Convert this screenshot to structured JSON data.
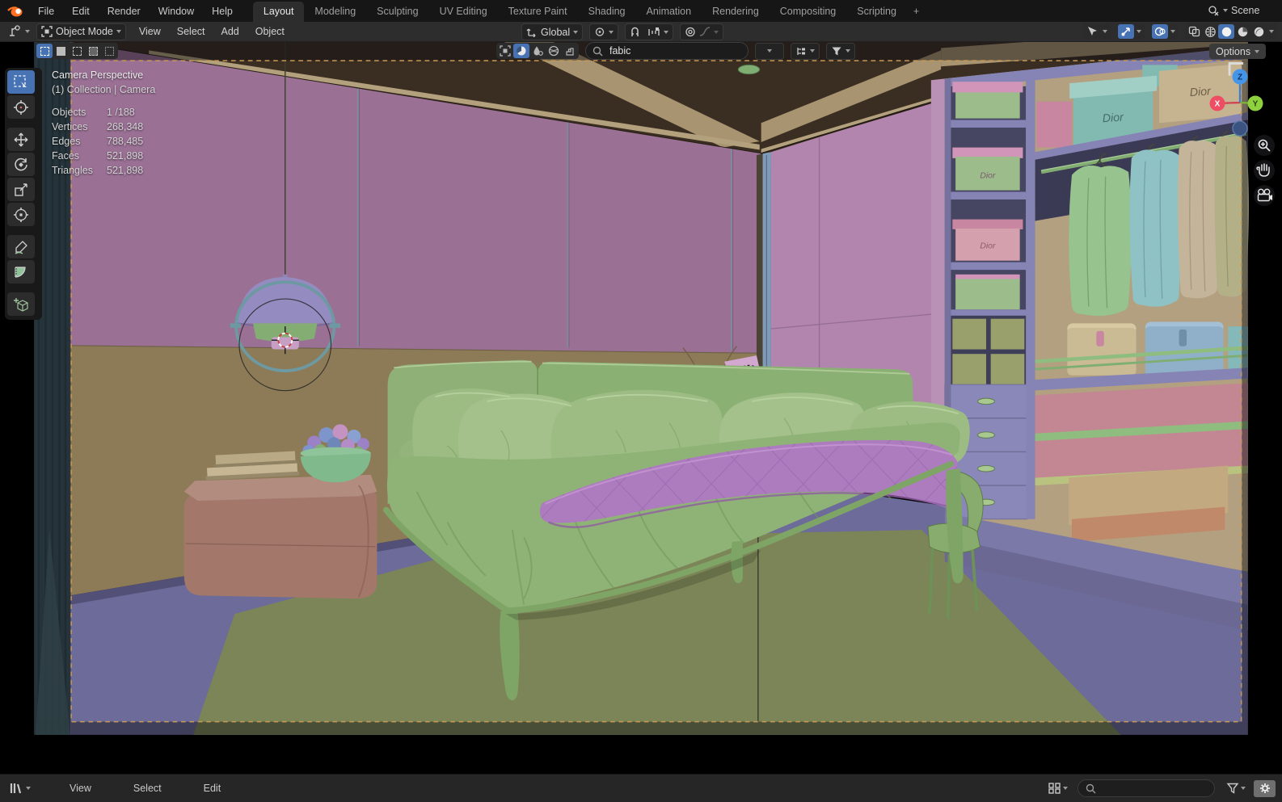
{
  "topbar": {
    "app_menus": [
      "File",
      "Edit",
      "Render",
      "Window",
      "Help"
    ],
    "workspace_tabs": [
      {
        "label": "Layout",
        "active": true
      },
      {
        "label": "Modeling",
        "active": false
      },
      {
        "label": "Sculpting",
        "active": false
      },
      {
        "label": "UV Editing",
        "active": false
      },
      {
        "label": "Texture Paint",
        "active": false
      },
      {
        "label": "Shading",
        "active": false
      },
      {
        "label": "Animation",
        "active": false
      },
      {
        "label": "Rendering",
        "active": false
      },
      {
        "label": "Compositing",
        "active": false
      },
      {
        "label": "Scripting",
        "active": false
      }
    ],
    "add_workspace_label": "+",
    "scene_name": "Scene"
  },
  "viewport_header": {
    "mode_label": "Object Mode",
    "menus": [
      "View",
      "Select",
      "Add",
      "Object"
    ],
    "orientation_label": "Global"
  },
  "tool_settings": {
    "search_value": "fabic",
    "options_label": "Options"
  },
  "viewport_overlay": {
    "view_title": "Camera Perspective",
    "view_subtitle": "(1) Collection | Camera",
    "stats": [
      {
        "label": "Objects",
        "value": "1 /188"
      },
      {
        "label": "Vertices",
        "value": "268,348"
      },
      {
        "label": "Edges",
        "value": "788,485"
      },
      {
        "label": "Faces",
        "value": "521,898"
      },
      {
        "label": "Triangles",
        "value": "521,898"
      }
    ]
  },
  "axis_gizmo": {
    "x_label": "X",
    "y_label": "Y",
    "z_label": "Z"
  },
  "status_bar": {
    "menus": [
      "View",
      "Select",
      "Edit"
    ],
    "search_value": ""
  },
  "scene": {
    "box_brand_label": "Dior"
  },
  "icons": {
    "blender-logo": "orange blender swirl",
    "editor-type-icon": "3d viewport",
    "object-mode-icon": "corner bracket square",
    "orientation-icon": "axes",
    "pivot-icon": "circle dot",
    "magnet-icon": "snap magnet",
    "snap-with-icon": "snap target",
    "proportional-icon": "concentric circles",
    "falloff-icon": "bell curve",
    "visibility-icon": "cursor eye",
    "gizmo-icon": "ne arrow",
    "overlays-icon": "two circles",
    "xray-icon": "overlap squares",
    "shading-wireframe-icon": "wire globe",
    "shading-solid-icon": "solid sphere",
    "shading-material-icon": "checker sphere",
    "shading-rendered-icon": "shaded sphere",
    "select-box-tool": "dashed square cursor",
    "cursor-tool": "crosshair circle",
    "move-tool": "four arrows",
    "rotate-tool": "circular arrows",
    "scale-tool": "square arrow",
    "transform-tool": "circle arrows",
    "annotate-tool": "pencil",
    "measure-tool": "protractor",
    "add-cube-tool": "cube plus",
    "zoom-icon": "magnifier plus",
    "pan-icon": "hand",
    "camera-view-icon": "movie camera",
    "grid-display-icon": "four squares",
    "filter-funnel-icon": "funnel",
    "gear-icon": "gear",
    "search-icon": "magnifier",
    "collection-filter-icons": "object, shading, material, world, brush"
  },
  "palette": {
    "ui_topbar": "#161616",
    "ui_header": "#2d2d2d",
    "ui_statusbar": "#262626",
    "accent_blue": "#4772b3",
    "text_main": "#d6d6d6",
    "camera_border": "#c99a55",
    "ceiling": "#3a2d21",
    "ceiling_band": "#a89470",
    "ceiling_band_light": "#b3a07c",
    "wall_left": "#9a7095",
    "wall_lower": "#8d7b58",
    "wall_seam": "#6e96a0",
    "door": "#b285ae",
    "door_seam": "#946d92",
    "door_frame_blue": "#7e9bb9",
    "floor": "#6c6b99",
    "rug": "#7c8557",
    "curtain": "#3b575d",
    "curtain_light": "#517177",
    "bed": "#8fb376",
    "bed_dark": "#6e9557",
    "bed_light": "#a3c28b",
    "bed_frame": "#7fa566",
    "headboard": "#8fb077",
    "pillow": "#9cbc83",
    "pillow_light": "#b7d29e",
    "quilt": "#ad7cbe",
    "quilt_dark": "#8f5ca4",
    "quilt_light": "#c495d2",
    "nightstand": "#a3786b",
    "nightstand_top": "#b28d7f",
    "nightstand_dark": "#8a6356",
    "book": "#c6b694",
    "bowl": "#7fb98c",
    "pendant_shade": "#948cc0",
    "pendant_green": "#83ad73",
    "pendant_pink": "#c79fc5",
    "pendant_ring": "#6d99a2",
    "desk_lamp": "#cfa3cb",
    "vase": "#b8a878",
    "closet_back": "#b2a080",
    "closet_frame": "#8683b5",
    "closet_frame_dark": "#75729f",
    "closet_gap": "#3b3a54",
    "door_edge": "#b990b6",
    "box_green": "#9cbc8b",
    "box_pink_lid": "#d095b8",
    "box_pink": "#d4a0ad",
    "box_rose": "#c986a0",
    "box_teal": "#82bab2",
    "box_tan": "#c6b491",
    "shirt_green": "#97c38e",
    "shirt_teal": "#8fc2c4",
    "shirt_tan": "#c4b49a",
    "shirt_olive": "#b3b088",
    "rod": "#82ad72",
    "hat_tan": "#cabb95",
    "hat_blue": "#8fb0c8",
    "hat_teal": "#85b8b8",
    "rose_panel": "#c28793",
    "rail": "#8fbc7f",
    "base_purple": "#7b79a8",
    "crate_tan": "#c3a97f",
    "crate_orange": "#c08a6a",
    "chair": "#87ac6e",
    "stand_teal": "#5d989c",
    "stand_teal_top": "#74b4b8",
    "drawer_purple": "#8a87b9",
    "handle": "#a8c890",
    "cubby": "#9aa06b"
  }
}
